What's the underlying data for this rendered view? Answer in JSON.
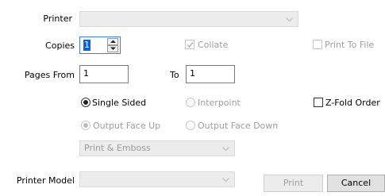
{
  "printer": {
    "label": "Printer",
    "value": ""
  },
  "copies": {
    "label": "Copies",
    "value": "1"
  },
  "collate": {
    "label": "Collate",
    "checked": true,
    "enabled": false
  },
  "print_to_file": {
    "label": "Print To File",
    "checked": false,
    "enabled": false
  },
  "pages": {
    "from_label": "Pages From",
    "from_value": "1",
    "to_label": "To",
    "to_value": "1"
  },
  "sides": {
    "single": {
      "label": "Single Sided",
      "selected": true
    },
    "interpoint": {
      "label": "Interpoint",
      "selected": false,
      "enabled": false
    }
  },
  "zfold": {
    "label": "Z-Fold Order",
    "checked": false
  },
  "output_face": {
    "up": {
      "label": "Output Face Up",
      "selected": true,
      "enabled": false
    },
    "down": {
      "label": "Output Face Down",
      "selected": false,
      "enabled": false
    }
  },
  "mode_select": {
    "value": "Print & Emboss"
  },
  "printer_model": {
    "label": "Printer Model",
    "value": ""
  },
  "buttons": {
    "print": "Print",
    "cancel": "Cancel"
  }
}
